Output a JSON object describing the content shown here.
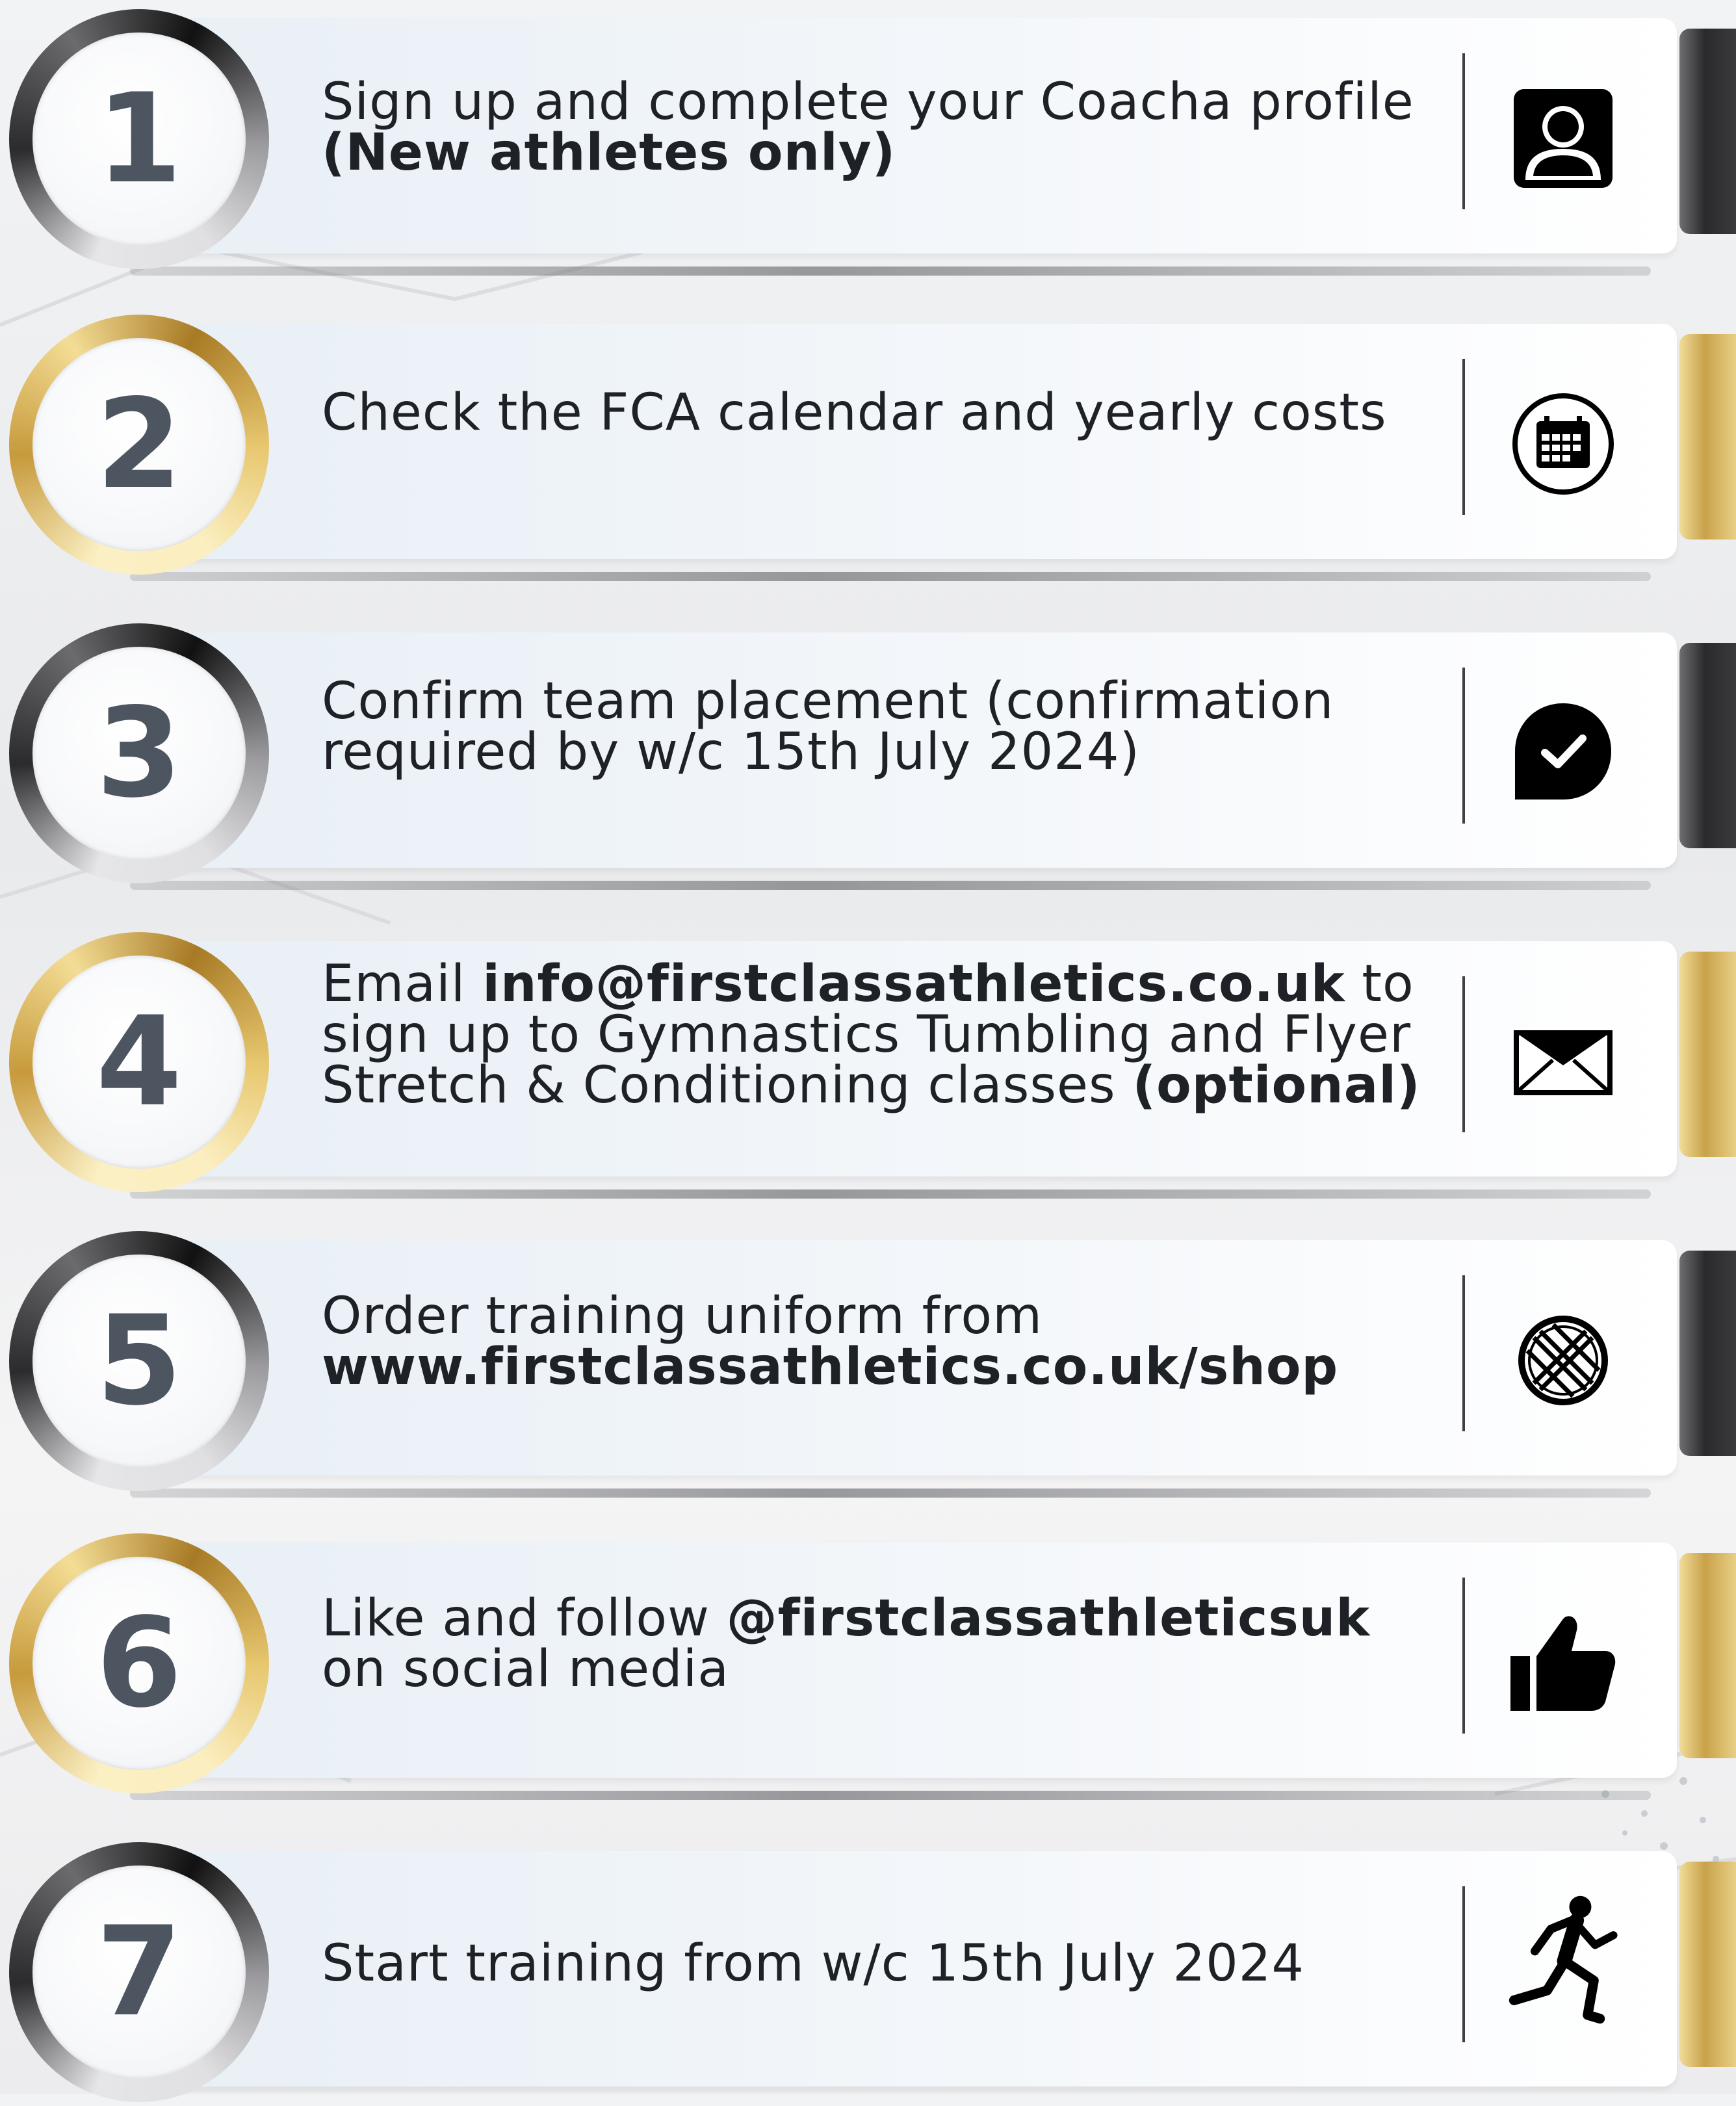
{
  "steps": [
    {
      "number": "1",
      "text": "Sign up and complete your Coacha profile",
      "bold": "(New athletes only)",
      "icon": "user-profile-icon",
      "accent": "dark"
    },
    {
      "number": "2",
      "text": "Check the FCA calendar and yearly costs",
      "icon": "calendar-icon",
      "accent": "gold"
    },
    {
      "number": "3",
      "text": "Confirm team placement (confirmation required by w/c 15th July 2024)",
      "icon": "check-bubble-icon",
      "accent": "dark"
    },
    {
      "number": "4",
      "text_before": "Email",
      "email": "info@firstclassathletics.co.uk",
      "text_after": "to sign up to Gymnastics Tumbling and Flyer Stretch & Conditioning classes",
      "bold": "(optional)",
      "icon": "envelope-icon",
      "accent": "gold"
    },
    {
      "number": "5",
      "text": "Order training uniform from",
      "url": "www.firstclassathletics.co.uk/shop",
      "icon": "globe-icon",
      "accent": "dark"
    },
    {
      "number": "6",
      "text_before": "Like and follow",
      "handle": "@firstclassathleticsuk",
      "text_after": "on social media",
      "icon": "thumbs-up-icon",
      "accent": "gold"
    },
    {
      "number": "7",
      "text": "Start training from w/c 15th July 2024",
      "icon": "runner-icon",
      "accent": "dark"
    }
  ],
  "colors": {
    "dark_accent": "#2a2a2c",
    "gold_accent": "#c9a24a",
    "number_color": "#4c5560",
    "text_color": "#1e2126"
  }
}
